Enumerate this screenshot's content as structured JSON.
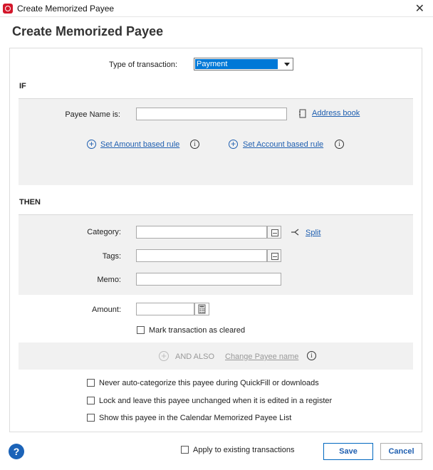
{
  "window": {
    "title": "Create Memorized Payee",
    "close": "✕"
  },
  "heading": "Create Memorized Payee",
  "type_of_transaction": {
    "label": "Type of transaction:",
    "value": "Payment"
  },
  "if_section": {
    "title": "IF",
    "payee_label": "Payee Name is:",
    "payee_value": "",
    "address_book": "Address book",
    "amount_rule": "Set Amount based rule",
    "account_rule": "Set Account based rule"
  },
  "then_section": {
    "title": "THEN",
    "category_label": "Category:",
    "category_value": "",
    "split": "Split",
    "tags_label": "Tags:",
    "tags_value": "",
    "memo_label": "Memo:",
    "memo_value": "",
    "amount_label": "Amount:",
    "amount_value": "",
    "mark_cleared": "Mark transaction as cleared",
    "and_also": "AND ALSO",
    "change_payee": "Change Payee name"
  },
  "options": [
    {
      "label": "Never auto-categorize this payee during QuickFill or downloads",
      "checked": false
    },
    {
      "label": "Lock and leave this payee unchanged when it is edited in a register",
      "checked": false
    },
    {
      "label": "Show this payee in the Calendar Memorized Payee List",
      "checked": false
    }
  ],
  "footer": {
    "help": "?",
    "apply_existing": "Apply to existing transactions",
    "save": "Save",
    "cancel": "Cancel"
  },
  "colors": {
    "accent": "#1f5fb0",
    "selection": "#0078d7",
    "brand": "#d3172b"
  }
}
